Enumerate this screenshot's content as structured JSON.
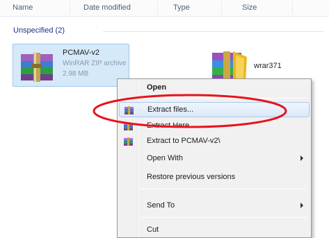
{
  "columns": {
    "name": "Name",
    "date_modified": "Date modified",
    "type": "Type",
    "size": "Size"
  },
  "group_label": "Unspecified (2)",
  "files": [
    {
      "name": "PCMAV-v2",
      "type": "WinRAR ZIP archive",
      "size": "2.98 MB",
      "icon": "winrar-archive-icon"
    },
    {
      "name": "wrar371",
      "icon": "winrar-installer-icon"
    }
  ],
  "context_menu": {
    "items": [
      {
        "label": "Open"
      },
      {
        "label": "Extract files...",
        "icon": "winrar-extract-icon"
      },
      {
        "label": "Extract Here",
        "icon": "winrar-extract-icon"
      },
      {
        "label": "Extract to PCMAV-v2\\",
        "icon": "winrar-extract-icon"
      },
      {
        "label": "Open With"
      },
      {
        "label": "Restore previous versions"
      },
      {
        "label": "Send To"
      },
      {
        "label": "Cut"
      }
    ]
  },
  "annotation": {
    "shape": "ellipse",
    "color": "#e8121b"
  },
  "colors": {
    "selection_fill": "#d6e9f8",
    "menu_background": "#f1f1f1",
    "highlight_border": "#a8c8ec"
  }
}
